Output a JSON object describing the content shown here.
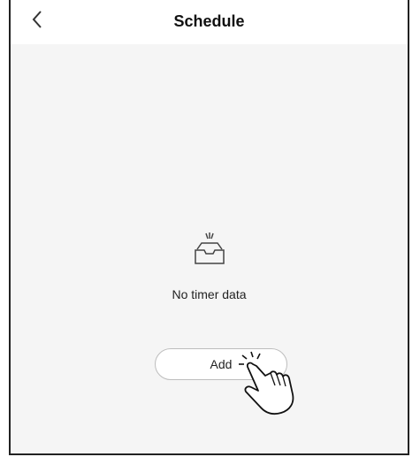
{
  "header": {
    "title": "Schedule"
  },
  "empty_state": {
    "message": "No timer data"
  },
  "actions": {
    "add_label": "Add"
  },
  "icons": {
    "back": "chevron-left-icon",
    "empty": "empty-tray-icon",
    "pointer": "hand-pointer-icon"
  }
}
